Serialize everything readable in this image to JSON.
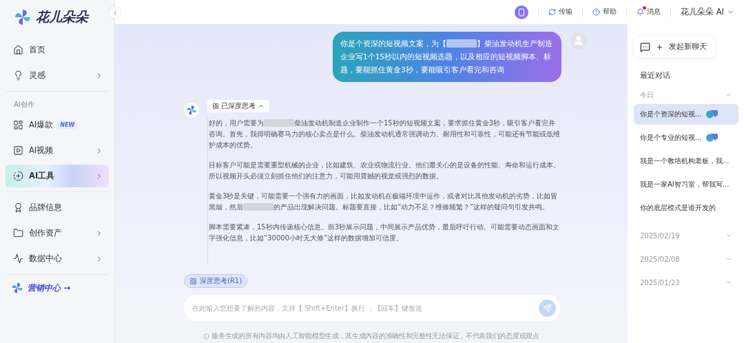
{
  "brand": {
    "name": "花儿朵朵"
  },
  "sidebar": {
    "groups": [
      {
        "items": [
          {
            "label": "首页",
            "submenu": false,
            "selected": false
          },
          {
            "label": "灵感",
            "submenu": true,
            "selected": false
          }
        ]
      },
      {
        "heading": "AI创作",
        "items": [
          {
            "label": "AI爆款",
            "badge": "NEW",
            "submenu": false,
            "selected": false
          },
          {
            "label": "AI视频",
            "submenu": true,
            "selected": false
          },
          {
            "label": "AI工具",
            "submenu": true,
            "selected": true
          }
        ]
      },
      {
        "items": [
          {
            "label": "品牌信息",
            "submenu": false,
            "selected": false
          },
          {
            "label": "创作资产",
            "submenu": true,
            "selected": false
          },
          {
            "label": "数据中心",
            "submenu": true,
            "selected": false
          }
        ]
      }
    ],
    "promo": {
      "label": "营销中心",
      "arrow": "→"
    }
  },
  "topbar": {
    "links": [
      {
        "label": "传输",
        "unread": false
      },
      {
        "label": "帮助",
        "unread": false
      },
      {
        "label": "消息",
        "unread": true
      }
    ],
    "account": "花儿朵朵 AI"
  },
  "chat": {
    "user_message": [
      {
        "kind": "text",
        "text": "你是个资深的短视频文案，为【"
      },
      {
        "kind": "redacted"
      },
      {
        "kind": "text",
        "text": "】柴油发动机生产制造企业写1个15秒以内的短视频选题，以及相应的短视频脚本、标题，要能抓住黄金3秒，要能吸引客户看完和咨询"
      }
    ],
    "thinking": {
      "label": "已深度思考",
      "expanded": true
    },
    "reasoning": [
      [
        {
          "kind": "text",
          "text": "好的，用户需要为"
        },
        {
          "kind": "redacted"
        },
        {
          "kind": "text",
          "text": "柴油发动机制造企业制作一个15秒的短视频文案，要求抓住黄金3秒，吸引客户看完并咨询。首先，我得明确赛马力的核心卖点是什么。柴油发动机通常强调动力、耐用性和可靠性，可能还有节能或低维护成本的优势。"
        }
      ],
      [
        {
          "kind": "text",
          "text": "目标客户可能是需要重型机械的企业，比如建筑、农业或物流行业。他们最关心的是设备的性能、寿命和运行成本。所以视频开头必须立刻抓住他们的注意力，可能用震撼的视觉或强烈的数据。"
        }
      ],
      [
        {
          "kind": "text",
          "text": "黄金3秒是关键，可能需要一个强有力的画面，比如发动机在极端环境中运作，或者对比其他发动机的劣势，比如冒黑烟，然后"
        },
        {
          "kind": "redacted"
        },
        {
          "kind": "text",
          "text": "的产品出现解决问题。标题要直接，比如“动力不足？维修频繁？”这样的疑问句引发共鸣。"
        }
      ],
      [
        {
          "kind": "text",
          "text": "脚本需要紧凑，15秒内传递核心信息。前3秒展示问题，中间展示产品优势，最后呼吁行动。可能需要动态画面和文字强化信息，比如“30000小时无大修”这样的数据增加可信度。"
        }
      ]
    ]
  },
  "composer": {
    "mode": {
      "label": "深度思考(R1)",
      "selected": true
    },
    "placeholder": "在此输入您想要了解的内容，支持【 Shift+Enter】换行 ，【回车】键发送",
    "disclaimer": "服务生成的所有内容均由人工智能模型生成，其生成内容的准确性和完整性无法保证，不代表我们的态度或观点"
  },
  "history": {
    "new_chat": "发起新聊天",
    "title": "最近对话",
    "groups": [
      {
        "label": "今日",
        "expanded": true,
        "items": [
          {
            "title": "你是个资深的短视...",
            "kind": "agent",
            "selected": true
          },
          {
            "title": "你是个专业的短视...",
            "kind": "agent",
            "selected": false
          },
          {
            "title": "我是一个教培机构老板，我...",
            "kind": "plain",
            "selected": false
          },
          {
            "title": "我是一家AI智习室，帮我写...",
            "kind": "plain",
            "selected": false
          },
          {
            "title": "你的底层模式是谁开发的",
            "kind": "plain",
            "selected": false
          }
        ]
      },
      {
        "label": "2025/02/19",
        "expanded": false
      },
      {
        "label": "2025/02/08",
        "expanded": false
      },
      {
        "label": "2025/01/23",
        "expanded": false
      }
    ]
  }
}
